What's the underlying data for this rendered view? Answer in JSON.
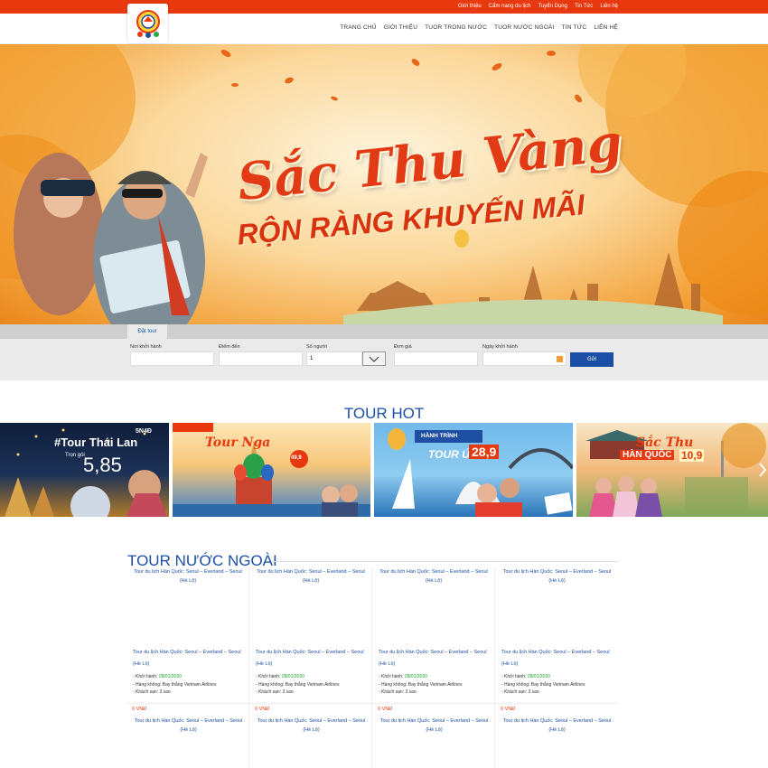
{
  "topbar": {
    "links": [
      "Giới thiệu",
      "Cẩm nang du lịch",
      "Tuyển Dụng",
      "Tin Tức",
      "Liên hệ"
    ]
  },
  "nav": {
    "items": [
      "TRANG CHỦ",
      "GIỚI THIỆU",
      "TUOR TRONG NƯỚC",
      "TUOR NƯỚC NGOÀI",
      "TIN TỨC",
      "LIÊN HỆ"
    ]
  },
  "banner": {
    "title": "Sắc Thu Vàng",
    "subtitle": "RỘN RÀNG KHUYẾN MÃI"
  },
  "search": {
    "tab": "Đặt tour",
    "fields": {
      "departure_label": "Nơi khởi hành",
      "destination_label": "Điểm đến",
      "people_label": "Số người",
      "people_value": "1",
      "price_label": "Đơn giá",
      "date_label": "Ngày khởi hành"
    },
    "submit": "Gửi"
  },
  "hot": {
    "heading": "TOUR HOT",
    "cards": [
      {
        "top": "5N4Đ",
        "name": "#Tour Thái Lan",
        "price_prefix": "Trọn gói",
        "price": "5,85"
      },
      {
        "name": "Tour Nga",
        "price": "49,9"
      },
      {
        "banner": "HÀNH TRÌNH",
        "name": "TOUR ÚC",
        "price": "28,9"
      },
      {
        "name": "Sắc Thu",
        "name2": "HÀN QUỐC",
        "price": "10,9"
      }
    ]
  },
  "foreign": {
    "heading": "TOUR NƯỚC NGOÀI",
    "cards": [
      {
        "title": "Tour du lịch Hàn Quốc: Seoul – Everland – Seoul (Hè Lộ)",
        "name": "Tour du lịch Hàn Quốc: Seoul – Everland – Seoul (Hè Lộ)",
        "depart_label": "- Khởi hành:",
        "depart_date": "28/01/2020",
        "airline": "- Hàng không: Bay thẳng Vietnam Airlines",
        "hotel": "- Khách sạn: 3 sao",
        "price": "0 VNĐ",
        "title2": "Tour du lịch Hàn Quốc: Seoul – Everland – Seoul (Hè Lộ)"
      },
      {
        "title": "Tour du lịch Hàn Quốc: Seoul – Everland – Seoul (Hè Lộ)",
        "name": "Tour du lịch Hàn Quốc: Seoul – Everland – Seoul (Hè Lộ)",
        "depart_label": "- Khởi hành:",
        "depart_date": "28/01/2020",
        "airline": "- Hàng không: Bay thẳng Vietnam Airlines",
        "hotel": "- Khách sạn: 3 sao",
        "price": "0 VNĐ",
        "title2": "Tour du lịch Hàn Quốc: Seoul – Everland – Seoul (Hè Lộ)"
      },
      {
        "title": "Tour du lịch Hàn Quốc: Seoul – Everland – Seoul (Hè Lộ)",
        "name": "Tour du lịch Hàn Quốc: Seoul – Everland – Seoul (Hè Lộ)",
        "depart_label": "- Khởi hành:",
        "depart_date": "28/01/2020",
        "airline": "- Hàng không: Bay thẳng Vietnam Airlines",
        "hotel": "- Khách sạn: 3 sao",
        "price": "0 VNĐ",
        "title2": "Tour du lịch Hàn Quốc: Seoul – Everland – Seoul (Hè Lộ)"
      },
      {
        "title": "Tour du lịch Hàn Quốc: Seoul – Everland – Seoul (Hè Lộ)",
        "name": "Tour du lịch Hàn Quốc: Seoul – Everland – Seoul (Hè Lộ)",
        "depart_label": "- Khởi hành:",
        "depart_date": "28/01/2020",
        "airline": "- Hàng không: Bay thẳng Vietnam Airlines",
        "hotel": "- Khách sạn: 3 sao",
        "price": "0 VNĐ",
        "title2": "Tour du lịch Hàn Quốc: Seoul – Everland – Seoul (Hè Lộ)"
      }
    ]
  },
  "colors": {
    "brand_orange": "#e8380d",
    "brand_blue": "#1b4fa5",
    "date_green": "#1aa12d"
  },
  "icons": [
    "logo-icon",
    "calendar-icon",
    "chevron-down-icon",
    "carousel-next-icon"
  ]
}
